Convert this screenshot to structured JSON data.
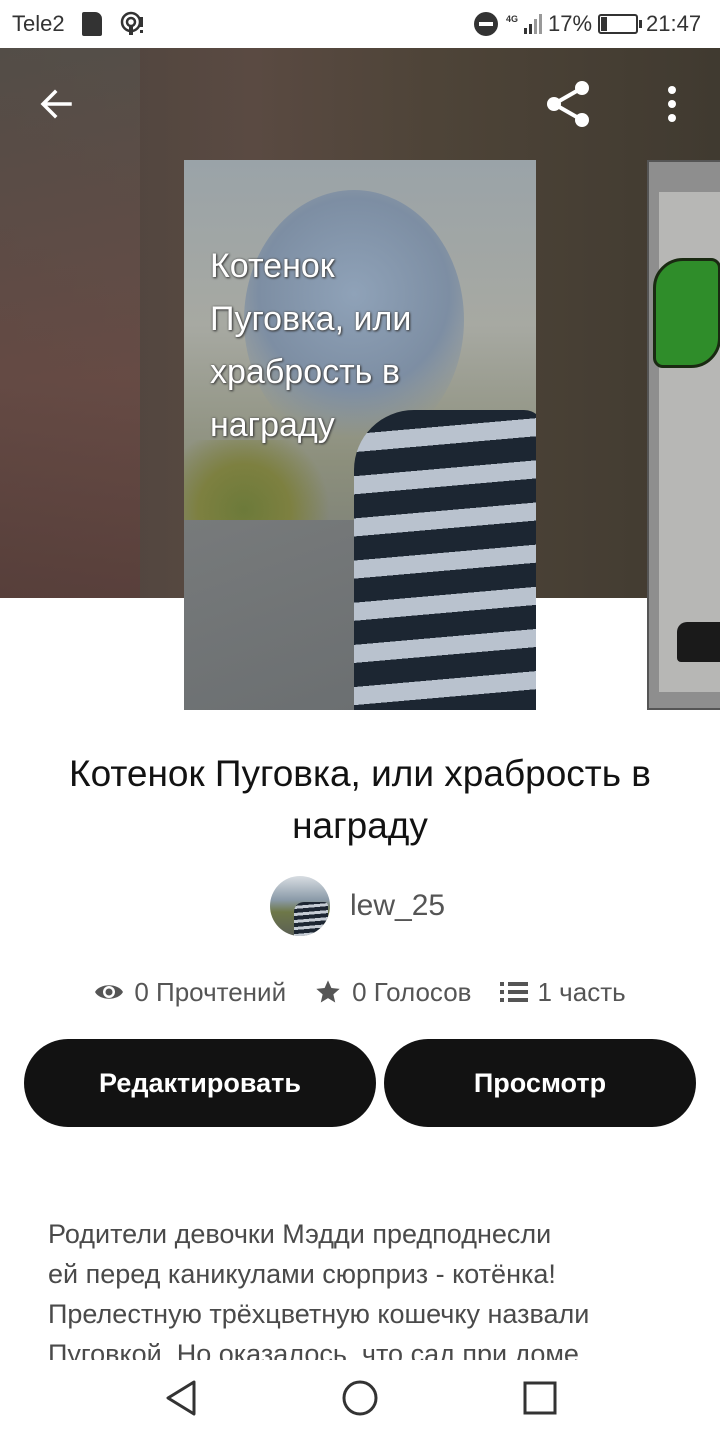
{
  "status_bar": {
    "carrier": "Tele2",
    "network_label": "4G",
    "battery_percent": "17%",
    "time": "21:47",
    "icons": [
      "sd-card-icon",
      "hotspot-icon",
      "do-not-disturb-icon",
      "signal-icon",
      "battery-charging-icon"
    ]
  },
  "header": {
    "icons": [
      "back-arrow-icon",
      "share-icon",
      "more-vertical-icon"
    ]
  },
  "cover": {
    "title_lines": [
      "Котенок",
      "Пуговка, или",
      "храбрость в",
      "награду"
    ]
  },
  "story": {
    "title": "Котенок Пуговка, или храбрость в награду",
    "author": "lew_25"
  },
  "stats": {
    "reads": "0 Прочтений",
    "votes": "0 Голосов",
    "parts": "1 часть"
  },
  "actions": {
    "edit_label": "Редактировать",
    "view_label": "Просмотр"
  },
  "description": {
    "lines": [
      "Родители девочки Мэдди предподнесли",
      "ей перед каникулами сюрприз - котёнка!",
      "Прелестную трёхцветную кошечку назвали",
      "Пуговкой. Но оказалось, что сад при доме"
    ]
  },
  "nav_bar": {
    "icons": [
      "nav-back-icon",
      "nav-home-icon",
      "nav-recents-icon"
    ]
  },
  "colors": {
    "button_bg": "#121212",
    "button_text": "#ffffff",
    "secondary_text": "#555555"
  }
}
